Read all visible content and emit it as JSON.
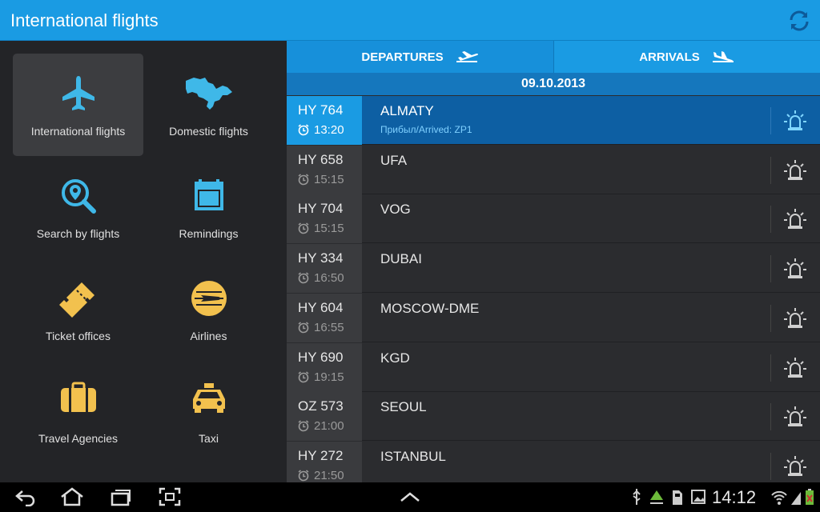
{
  "header": {
    "title": "International flights",
    "refresh_icon": "refresh-icon"
  },
  "menu": [
    {
      "label": "International flights",
      "icon": "plane-icon",
      "active": true
    },
    {
      "label": "Domestic flights",
      "icon": "uzbekistan-map-icon",
      "active": false
    },
    {
      "label": "Search by flights",
      "icon": "search-pin-icon",
      "active": false
    },
    {
      "label": "Remindings",
      "icon": "calendar-icon",
      "active": false
    },
    {
      "label": "Ticket offices",
      "icon": "ticket-icon",
      "active": false
    },
    {
      "label": "Airlines",
      "icon": "airline-logo-icon",
      "active": false
    },
    {
      "label": "Travel Agencies",
      "icon": "suitcase-icon",
      "active": false
    },
    {
      "label": "Taxi",
      "icon": "taxi-icon",
      "active": false
    }
  ],
  "tabs": {
    "departures": "DEPARTURES",
    "arrivals": "ARRIVALS"
  },
  "date": "09.10.2013",
  "flights": [
    {
      "number": "HY 764",
      "time": "13:20",
      "destination": "ALMATY",
      "status": "Прибыл/Arrived: ZP1",
      "selected": true
    },
    {
      "number": "HY 658",
      "time": "15:15",
      "destination": "UFA",
      "status": "",
      "selected": false
    },
    {
      "number": "HY 704",
      "time": "15:15",
      "destination": "VOG",
      "status": "",
      "selected": false
    },
    {
      "number": "HY 334",
      "time": "16:50",
      "destination": "DUBAI",
      "status": "",
      "selected": false
    },
    {
      "number": "HY 604",
      "time": "16:55",
      "destination": "MOSCOW-DME",
      "status": "",
      "selected": false
    },
    {
      "number": "HY 690",
      "time": "19:15",
      "destination": "KGD",
      "status": "",
      "selected": false
    },
    {
      "number": "OZ 573",
      "time": "21:00",
      "destination": "SEOUL",
      "status": "",
      "selected": false
    },
    {
      "number": "HY 272",
      "time": "21:50",
      "destination": "ISTANBUL",
      "status": "",
      "selected": false
    }
  ],
  "system": {
    "clock": "14:12"
  },
  "colors": {
    "accent": "#1a9be3",
    "icon_blue": "#3fb8e8",
    "icon_yellow": "#f2c14e",
    "selected_row": "#0d5fa3"
  }
}
